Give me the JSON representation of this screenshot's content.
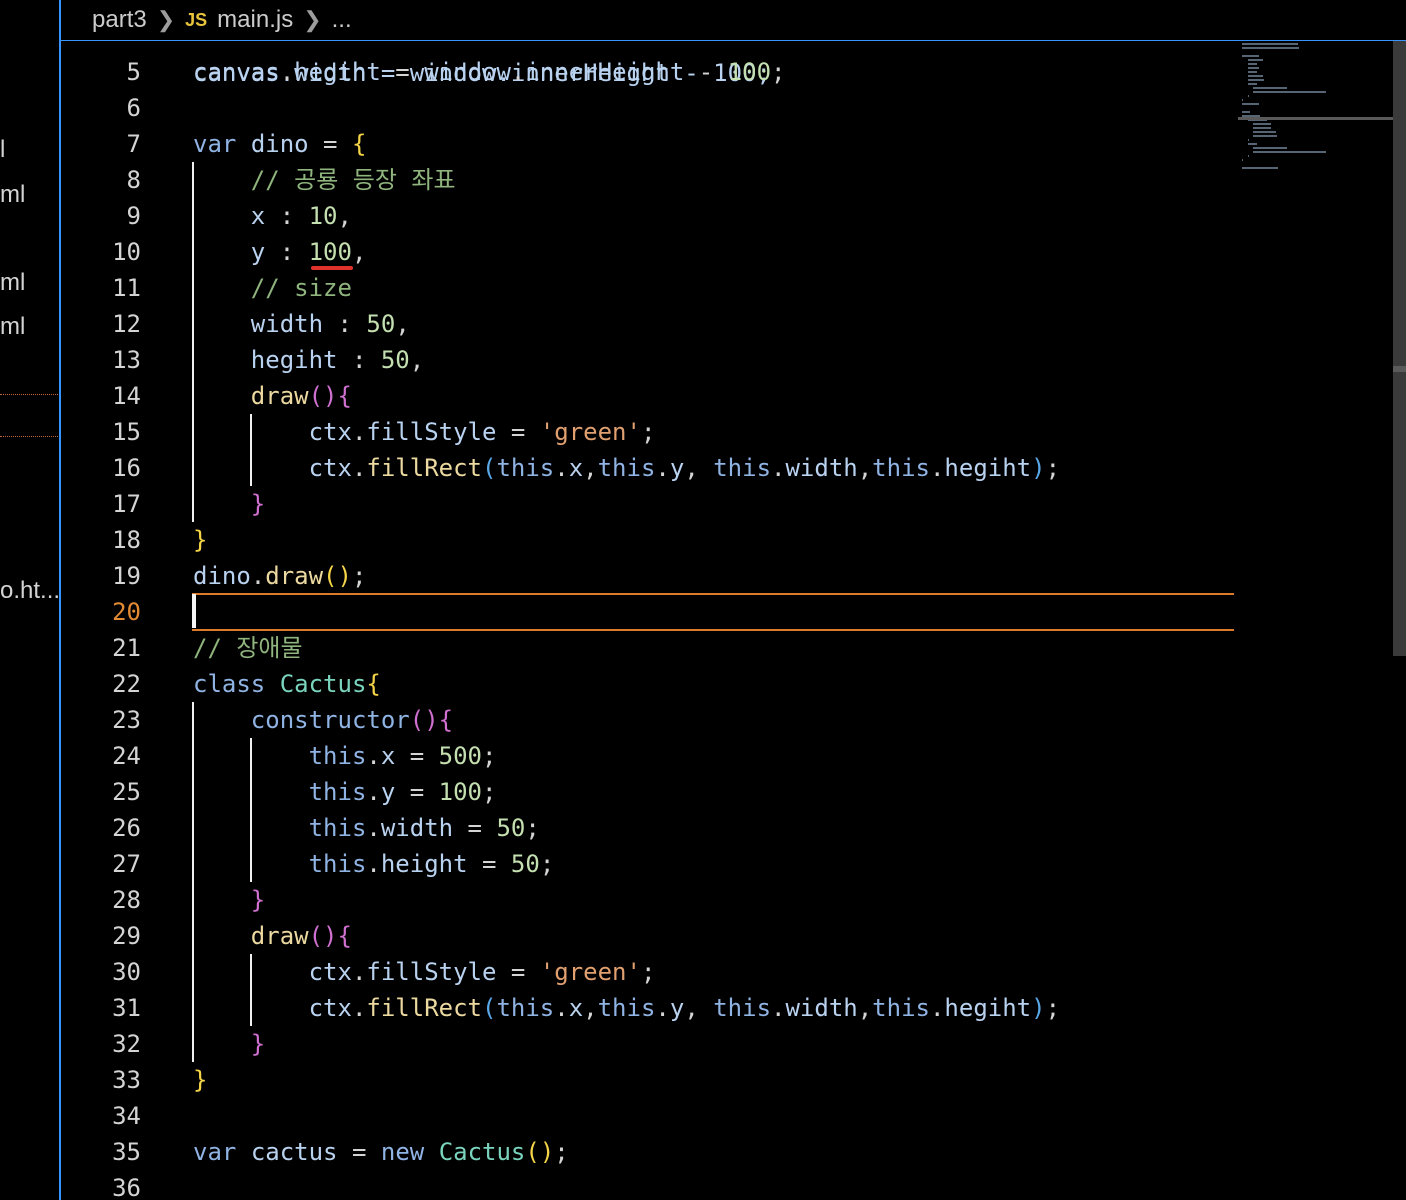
{
  "breadcrumb": {
    "folder": "part3",
    "file_icon": "JS",
    "file": "main.js",
    "ellipsis": "..."
  },
  "sidebar": {
    "items": [
      "l",
      "ml",
      "ml",
      "ml",
      "o.ht..."
    ]
  },
  "editor": {
    "current_line": 20,
    "partial_top_line": "canvas.width = window.innerHeight - 100;",
    "lines": [
      {
        "n": 5,
        "tokens": [
          [
            "var",
            "canvas"
          ],
          [
            "p",
            "."
          ],
          [
            "var",
            "hegiht"
          ],
          [
            "p",
            " = "
          ],
          [
            "var",
            "window"
          ],
          [
            "p",
            "."
          ],
          [
            "var",
            "innerHeight"
          ],
          [
            "p",
            " - "
          ],
          [
            "num",
            "100"
          ],
          [
            "p",
            ";"
          ]
        ]
      },
      {
        "n": 6,
        "tokens": []
      },
      {
        "n": 7,
        "tokens": [
          [
            "kw",
            "var"
          ],
          [
            "p",
            " "
          ],
          [
            "var",
            "dino"
          ],
          [
            "p",
            " = "
          ],
          [
            "b1",
            "{"
          ]
        ]
      },
      {
        "n": 8,
        "tokens": [
          [
            "p",
            "    "
          ],
          [
            "cm",
            "// 공룡 등장 좌표"
          ]
        ]
      },
      {
        "n": 9,
        "tokens": [
          [
            "p",
            "    "
          ],
          [
            "var",
            "x"
          ],
          [
            "p",
            " : "
          ],
          [
            "num",
            "10"
          ],
          [
            "p",
            ","
          ]
        ]
      },
      {
        "n": 10,
        "tokens": [
          [
            "p",
            "    "
          ],
          [
            "var",
            "y"
          ],
          [
            "p",
            " : "
          ],
          [
            "num",
            "100"
          ],
          [
            "p",
            ","
          ]
        ]
      },
      {
        "n": 11,
        "tokens": [
          [
            "p",
            "    "
          ],
          [
            "cm",
            "// size"
          ]
        ]
      },
      {
        "n": 12,
        "tokens": [
          [
            "p",
            "    "
          ],
          [
            "var",
            "width"
          ],
          [
            "p",
            " : "
          ],
          [
            "num",
            "50"
          ],
          [
            "p",
            ","
          ]
        ]
      },
      {
        "n": 13,
        "tokens": [
          [
            "p",
            "    "
          ],
          [
            "var",
            "hegiht"
          ],
          [
            "p",
            " : "
          ],
          [
            "num",
            "50"
          ],
          [
            "p",
            ","
          ]
        ]
      },
      {
        "n": 14,
        "tokens": [
          [
            "p",
            "    "
          ],
          [
            "fn",
            "draw"
          ],
          [
            "b2",
            "(){"
          ]
        ]
      },
      {
        "n": 15,
        "tokens": [
          [
            "p",
            "        "
          ],
          [
            "var",
            "ctx"
          ],
          [
            "p",
            "."
          ],
          [
            "var",
            "fillStyle"
          ],
          [
            "p",
            " = "
          ],
          [
            "str",
            "'green'"
          ],
          [
            "p",
            ";"
          ]
        ]
      },
      {
        "n": 16,
        "tokens": [
          [
            "p",
            "        "
          ],
          [
            "var",
            "ctx"
          ],
          [
            "p",
            "."
          ],
          [
            "fn",
            "fillRect"
          ],
          [
            "b3",
            "("
          ],
          [
            "kw",
            "this"
          ],
          [
            "p",
            "."
          ],
          [
            "var",
            "x"
          ],
          [
            "p",
            ","
          ],
          [
            "kw",
            "this"
          ],
          [
            "p",
            "."
          ],
          [
            "var",
            "y"
          ],
          [
            "p",
            ", "
          ],
          [
            "kw",
            "this"
          ],
          [
            "p",
            "."
          ],
          [
            "var",
            "width"
          ],
          [
            "p",
            ","
          ],
          [
            "kw",
            "this"
          ],
          [
            "p",
            "."
          ],
          [
            "var",
            "hegiht"
          ],
          [
            "b3",
            ")"
          ],
          [
            "p",
            ";"
          ]
        ]
      },
      {
        "n": 17,
        "tokens": [
          [
            "p",
            "    "
          ],
          [
            "b2",
            "}"
          ]
        ]
      },
      {
        "n": 18,
        "tokens": [
          [
            "b1",
            "}"
          ]
        ]
      },
      {
        "n": 19,
        "tokens": [
          [
            "var",
            "dino"
          ],
          [
            "p",
            "."
          ],
          [
            "fn",
            "draw"
          ],
          [
            "b1",
            "()"
          ],
          [
            "p",
            ";"
          ]
        ]
      },
      {
        "n": 20,
        "tokens": []
      },
      {
        "n": 21,
        "tokens": [
          [
            "cm",
            "// 장애물"
          ]
        ]
      },
      {
        "n": 22,
        "tokens": [
          [
            "kw",
            "class"
          ],
          [
            "p",
            " "
          ],
          [
            "cls",
            "Cactus"
          ],
          [
            "b1",
            "{"
          ]
        ]
      },
      {
        "n": 23,
        "tokens": [
          [
            "p",
            "    "
          ],
          [
            "kw",
            "constructor"
          ],
          [
            "b2",
            "(){"
          ]
        ]
      },
      {
        "n": 24,
        "tokens": [
          [
            "p",
            "        "
          ],
          [
            "kw",
            "this"
          ],
          [
            "p",
            "."
          ],
          [
            "var",
            "x"
          ],
          [
            "p",
            " = "
          ],
          [
            "num",
            "500"
          ],
          [
            "p",
            ";"
          ]
        ]
      },
      {
        "n": 25,
        "tokens": [
          [
            "p",
            "        "
          ],
          [
            "kw",
            "this"
          ],
          [
            "p",
            "."
          ],
          [
            "var",
            "y"
          ],
          [
            "p",
            " = "
          ],
          [
            "num",
            "100"
          ],
          [
            "p",
            ";"
          ]
        ]
      },
      {
        "n": 26,
        "tokens": [
          [
            "p",
            "        "
          ],
          [
            "kw",
            "this"
          ],
          [
            "p",
            "."
          ],
          [
            "var",
            "width"
          ],
          [
            "p",
            " = "
          ],
          [
            "num",
            "50"
          ],
          [
            "p",
            ";"
          ]
        ]
      },
      {
        "n": 27,
        "tokens": [
          [
            "p",
            "        "
          ],
          [
            "kw",
            "this"
          ],
          [
            "p",
            "."
          ],
          [
            "var",
            "height"
          ],
          [
            "p",
            " = "
          ],
          [
            "num",
            "50"
          ],
          [
            "p",
            ";"
          ]
        ]
      },
      {
        "n": 28,
        "tokens": [
          [
            "p",
            "    "
          ],
          [
            "b2",
            "}"
          ]
        ]
      },
      {
        "n": 29,
        "tokens": [
          [
            "p",
            "    "
          ],
          [
            "fn",
            "draw"
          ],
          [
            "b2",
            "(){"
          ]
        ]
      },
      {
        "n": 30,
        "tokens": [
          [
            "p",
            "        "
          ],
          [
            "var",
            "ctx"
          ],
          [
            "p",
            "."
          ],
          [
            "var",
            "fillStyle"
          ],
          [
            "p",
            " = "
          ],
          [
            "str",
            "'green'"
          ],
          [
            "p",
            ";"
          ]
        ]
      },
      {
        "n": 31,
        "tokens": [
          [
            "p",
            "        "
          ],
          [
            "var",
            "ctx"
          ],
          [
            "p",
            "."
          ],
          [
            "fn",
            "fillRect"
          ],
          [
            "b3",
            "("
          ],
          [
            "kw",
            "this"
          ],
          [
            "p",
            "."
          ],
          [
            "var",
            "x"
          ],
          [
            "p",
            ","
          ],
          [
            "kw",
            "this"
          ],
          [
            "p",
            "."
          ],
          [
            "var",
            "y"
          ],
          [
            "p",
            ", "
          ],
          [
            "kw",
            "this"
          ],
          [
            "p",
            "."
          ],
          [
            "var",
            "width"
          ],
          [
            "p",
            ","
          ],
          [
            "kw",
            "this"
          ],
          [
            "p",
            "."
          ],
          [
            "var",
            "hegiht"
          ],
          [
            "b3",
            ")"
          ],
          [
            "p",
            ";"
          ]
        ]
      },
      {
        "n": 32,
        "tokens": [
          [
            "p",
            "    "
          ],
          [
            "b2",
            "}"
          ]
        ]
      },
      {
        "n": 33,
        "tokens": [
          [
            "b1",
            "}"
          ]
        ]
      },
      {
        "n": 34,
        "tokens": []
      },
      {
        "n": 35,
        "tokens": [
          [
            "kw",
            "var"
          ],
          [
            "p",
            " "
          ],
          [
            "var",
            "cactus"
          ],
          [
            "p",
            " = "
          ],
          [
            "kw",
            "new"
          ],
          [
            "p",
            " "
          ],
          [
            "cls",
            "Cactus"
          ],
          [
            "b1",
            "()"
          ],
          [
            "p",
            ";"
          ]
        ]
      },
      {
        "n": 36,
        "tokens": []
      }
    ]
  },
  "colors": {
    "accent": "#3794ff",
    "current_line": "#d97a2c",
    "error": "#e0312b",
    "background": "#000000"
  }
}
